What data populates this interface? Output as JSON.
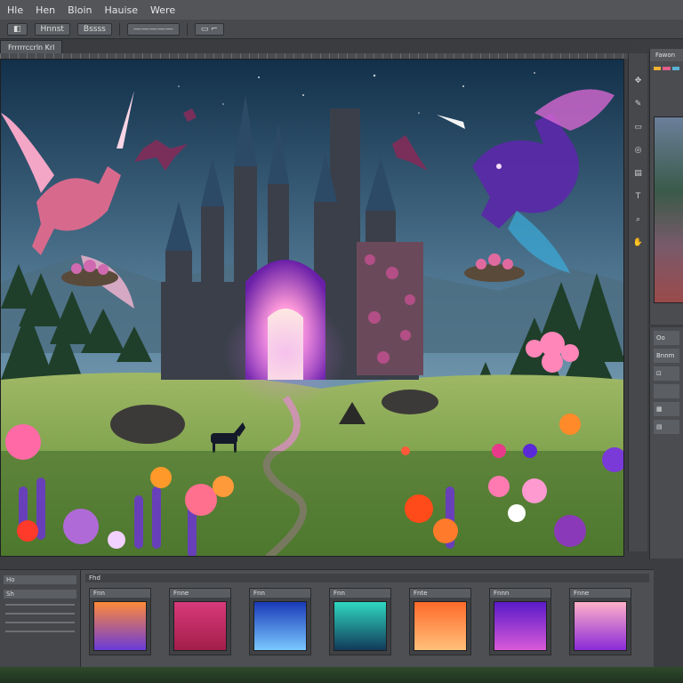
{
  "menu": {
    "items": [
      "Hle",
      "Hen",
      "Bloin",
      "Hauise",
      "Were"
    ]
  },
  "options": {
    "items": [
      "◧",
      "Hnnst",
      "Bssss",
      "—————",
      "▭ ⌐"
    ]
  },
  "document": {
    "tab_label": "Frrrrrccrln Krl"
  },
  "right_panel": {
    "title": "Fawon",
    "swatch_colors": [
      "#f7b232",
      "#e25c8a",
      "#59b2d6"
    ]
  },
  "right_panel2": {
    "rows": [
      "Oo",
      "Bnnm",
      "⊡",
      "",
      "▦",
      "▤"
    ]
  },
  "bottom_panel": {
    "header": "Fhd",
    "left_tabs": [
      "Ho",
      "Sh"
    ],
    "gradients": [
      {
        "label": "Fnn",
        "from": "#ff8a3a",
        "to": "#6a3bd8"
      },
      {
        "label": "Fnne",
        "from": "#d83a7a",
        "to": "#a31e4a"
      },
      {
        "label": "Fnn",
        "from": "#1a3ab8",
        "to": "#7ac8ff"
      },
      {
        "label": "Fnn",
        "from": "#2fd8c0",
        "to": "#123a5a"
      },
      {
        "label": "Fnte",
        "from": "#ff6a2a",
        "to": "#ffc07a"
      },
      {
        "label": "Fnnn",
        "from": "#5a1ac8",
        "to": "#d85ad8"
      },
      {
        "label": "Fnne",
        "from": "#ffb0c8",
        "to": "#8a2ad8"
      }
    ]
  },
  "scene": {
    "sky_top": "#16324d",
    "sky_bottom": "#6a8fa8",
    "meadow": "#7fa14b",
    "portal": "#c35dff"
  }
}
